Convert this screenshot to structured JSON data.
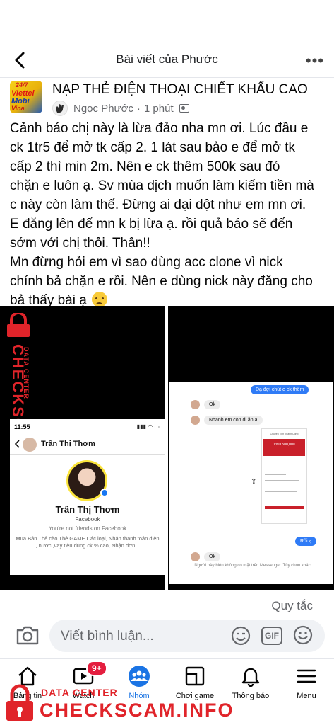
{
  "nav": {
    "title": "Bài viết của Phước",
    "more_label": "•••"
  },
  "post": {
    "group_avatar_text": [
      "24/7",
      "Viettel",
      "Mobi",
      "Vina"
    ],
    "group_name": "NẠP THẺ ĐIỆN THOẠI CHIẾT KHẤU CAO",
    "author": "Ngọc Phước",
    "time": "1 phút",
    "separator": "·",
    "text_lines": [
      "Cảnh báo chị này là lừa đảo nha mn ơi. Lúc đầu e",
      "ck 1tr5 để mở tk cấp 2. 1 lát sau bảo e để mở tk",
      "cấp 2 thì min 2m. Nên e ck thêm 500k sau đó",
      "chặn e luôn ạ. Sv mùa dịch muốn làm kiếm tiền mà",
      "c này còn làm thế. Đừng ai dại dột như em mn ơi.",
      "E đăng lên để mn k bị lừa ạ. rồi quả báo sẽ đến",
      "sớm với chị thôi. Thân!!",
      "Mn đừng hỏi em vì sao dùng acc clone vì nick",
      "chính bả chặn e rồi. Nên e dùng nick này đăng cho",
      "bả thấy bài ạ"
    ]
  },
  "photo_left": {
    "status_time": "11:55",
    "status_icons": "▮▮▮ ◠ ▭",
    "profile_name_top": "Trần Thị Thơm",
    "profile_name": "Trần Thị Thơm",
    "profile_source": "Facebook",
    "friend_status": "You're not friends on Facebook",
    "bio": "Mua Bán Thẻ cào Thẻ GAME Các loại, Nhận thanh toán điện , nước ,vay tiêu dùng ck % cao, Nhận đơn..."
  },
  "photo_right": {
    "msg_me_1": "Dạ đợi chút e ck thêm",
    "msg_them_1": "Ok",
    "msg_them_2": "Nhanh em còn đi ăn ạ",
    "bank_title": "Chuyển Tiền Thành Công",
    "bank_amount": "VND 500,000",
    "msg_me_2": "Rồi ạ",
    "msg_them_3": "Ok",
    "footer": "Người này hiện không có mặt trên Messenger. Tùy chọn khác"
  },
  "watermark": {
    "small": "DATA CENTER",
    "big": "CHECKSCAM.INFO"
  },
  "rules_link": "Quy tắc",
  "comment": {
    "placeholder": "Viết bình luận...",
    "gif_label": "GIF"
  },
  "tabs": [
    {
      "label": "Bảng tin",
      "icon": "home-icon"
    },
    {
      "label": "Watch",
      "icon": "watch-icon",
      "badge": "9+"
    },
    {
      "label": "Nhóm",
      "icon": "groups-icon",
      "active": true
    },
    {
      "label": "Chơi game",
      "icon": "gaming-icon"
    },
    {
      "label": "Thông báo",
      "icon": "bell-icon"
    },
    {
      "label": "Menu",
      "icon": "menu-icon"
    }
  ],
  "colors": {
    "accent": "#1b74e4",
    "badge": "#e41e3f",
    "watermark": "#e0242a"
  }
}
